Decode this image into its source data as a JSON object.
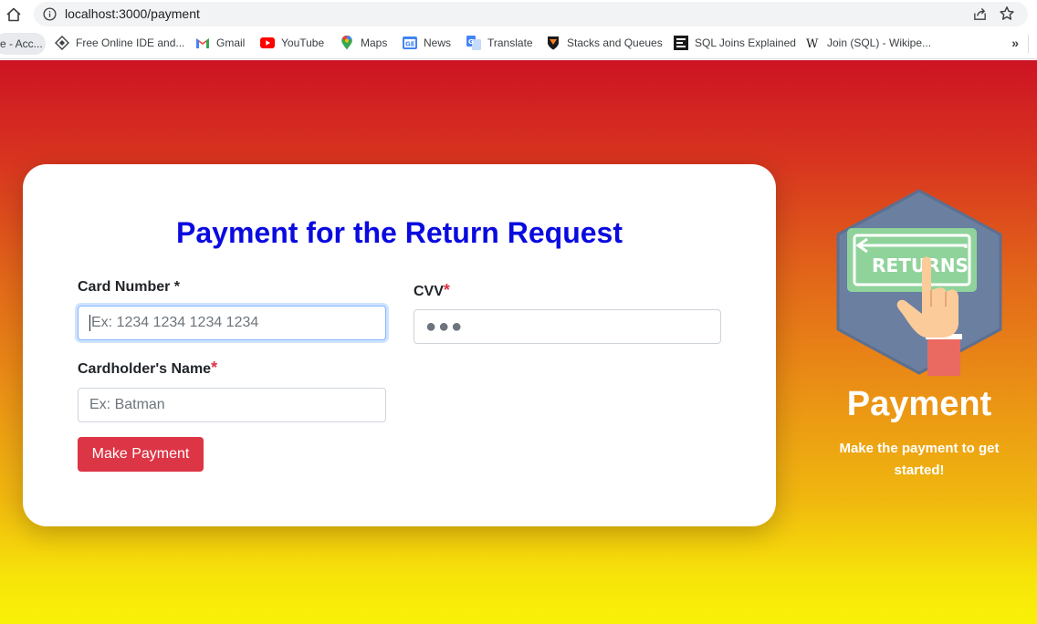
{
  "browser": {
    "url": "localhost:3000/payment",
    "bookmarks": [
      {
        "label": "e - Acc...",
        "icon": "bookmark-icon"
      },
      {
        "label": "Free Online IDE and...",
        "icon": "ide-icon"
      },
      {
        "label": "Gmail",
        "icon": "gmail-icon"
      },
      {
        "label": "YouTube",
        "icon": "youtube-icon"
      },
      {
        "label": "Maps",
        "icon": "maps-icon"
      },
      {
        "label": "News",
        "icon": "news-icon"
      },
      {
        "label": "Translate",
        "icon": "translate-icon"
      },
      {
        "label": "Stacks and Queues",
        "icon": "princeton-icon"
      },
      {
        "label": "SQL Joins Explained",
        "icon": "sql-icon"
      },
      {
        "label": "Join (SQL) - Wikipe...",
        "icon": "wikipedia-icon"
      }
    ],
    "more": "»"
  },
  "form": {
    "title": "Payment for the Return Request",
    "card_number_label": "Card Number *",
    "card_number_placeholder": "Ex: 1234 1234 1234 1234",
    "cvv_label": "CVV",
    "cvv_required": "*",
    "cvv_value": "●●●",
    "cardholder_label": "Cardholder's Name",
    "cardholder_required": "*",
    "cardholder_placeholder": "Ex: Batman",
    "submit_label": "Make Payment"
  },
  "side": {
    "badge_text": "RETURNS",
    "title": "Payment",
    "subtitle": "Make the payment to get started!"
  },
  "colors": {
    "title": "#0a0ae0",
    "button": "#dc3545",
    "gradient_top": "#cd1323",
    "gradient_bottom": "#f9f208",
    "hexagon": "#6b7fa1",
    "returns_sign": "#8fd39b"
  }
}
